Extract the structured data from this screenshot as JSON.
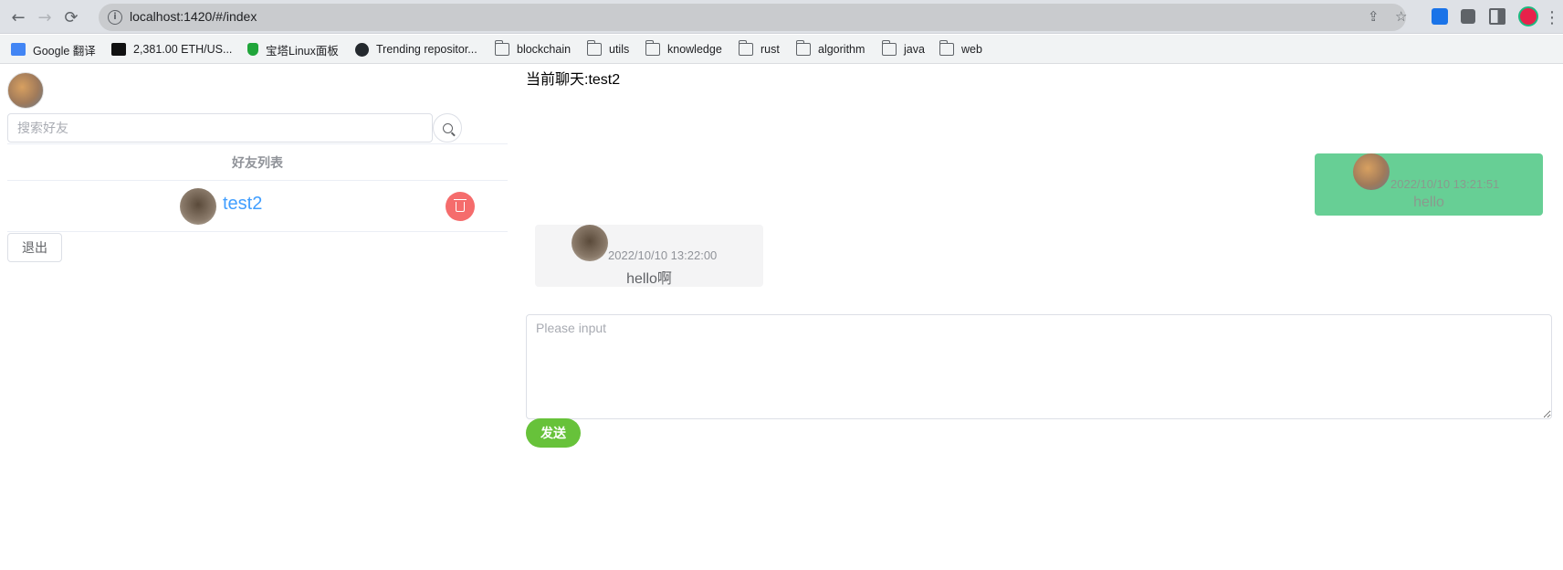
{
  "browser": {
    "url": "localhost:1420/#/index",
    "back_icon": "←",
    "forward_icon": "→",
    "reload_icon": "⟳",
    "share_icon": "⇪",
    "star_icon": "☆",
    "menu_icon": "⋮"
  },
  "bookmarks": [
    {
      "label": "Google 翻译",
      "icon": "google-translate-icon"
    },
    {
      "label": "2,381.00 ETH/US...",
      "icon": "binance-icon"
    },
    {
      "label": "宝塔Linux面板",
      "icon": "shield-icon"
    },
    {
      "label": "Trending repositor...",
      "icon": "github-icon"
    },
    {
      "label": "blockchain",
      "icon": "folder-icon"
    },
    {
      "label": "utils",
      "icon": "folder-icon"
    },
    {
      "label": "knowledge",
      "icon": "folder-icon"
    },
    {
      "label": "rust",
      "icon": "folder-icon"
    },
    {
      "label": "algorithm",
      "icon": "folder-icon"
    },
    {
      "label": "java",
      "icon": "folder-icon"
    },
    {
      "label": "web",
      "icon": "folder-icon"
    }
  ],
  "sidebar": {
    "search_placeholder": "搜索好友",
    "friends_header": "好友列表",
    "friends": [
      {
        "name": "test2"
      }
    ],
    "logout_label": "退出"
  },
  "chat": {
    "title": "当前聊天:test2",
    "messages": [
      {
        "side": "mine",
        "time": "2022/10/10 13:21:51",
        "text": "hello"
      },
      {
        "side": "theirs",
        "time": "2022/10/10 13:22:00",
        "text": "hello啊"
      }
    ],
    "input_placeholder": "Please input",
    "send_label": "发送"
  },
  "colors": {
    "mine_bubble": "#67cf95",
    "theirs_bubble": "#f4f4f5",
    "send_button": "#67c23a",
    "delete_button": "#f56c6c",
    "link": "#409eff"
  }
}
